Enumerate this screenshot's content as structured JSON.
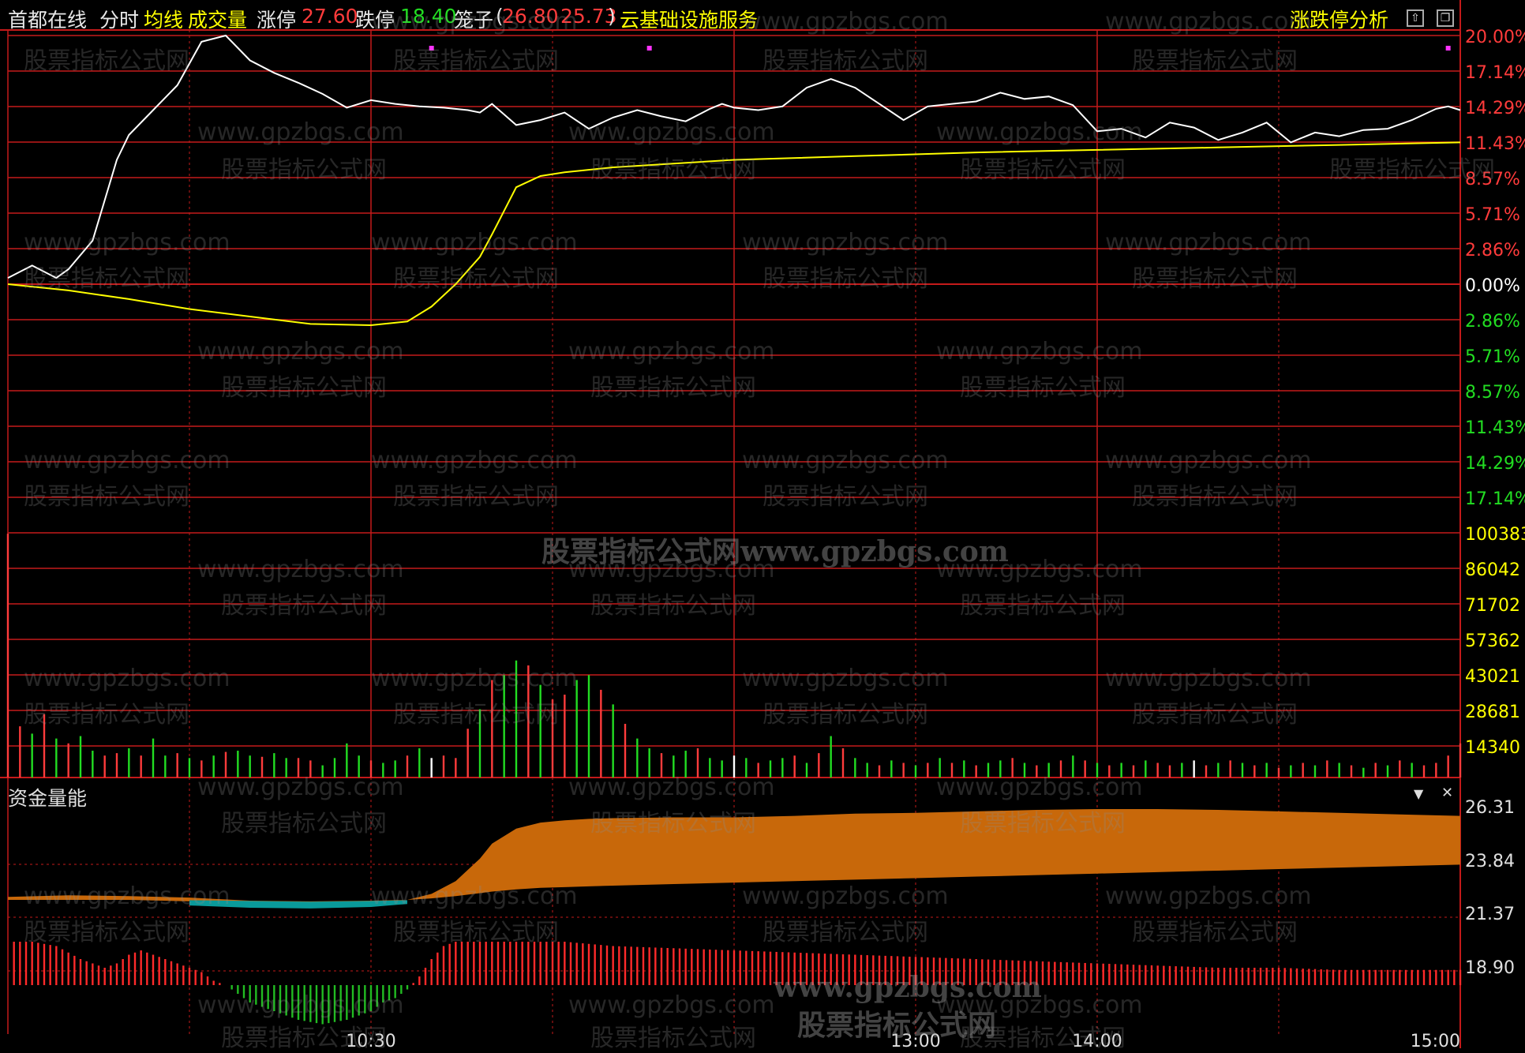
{
  "header": {
    "stock_name": "首都在线",
    "mode_label": "分时",
    "avg_label": "均线",
    "volume_label": "成交量",
    "limit_up_label": "涨停",
    "limit_up_value": "27.60",
    "limit_down_label": "跌停",
    "limit_down_value": "18.40",
    "cage_label": "笼子",
    "cage_open": "(",
    "cage_high": "26.80",
    "cage_low": "25.73",
    "cage_close": ")",
    "sector": "云基础设施服务",
    "analysis_button": "涨跌停分析",
    "btn_up_icon": "⇧",
    "btn_max_icon": "❐"
  },
  "price_axis": {
    "labels": [
      "20.00%",
      "17.14%",
      "14.29%",
      "11.43%",
      "8.57%",
      "5.71%",
      "2.86%",
      "0.00%",
      "2.86%",
      "5.71%",
      "8.57%",
      "11.43%",
      "14.29%",
      "17.14%"
    ],
    "colors": [
      "#ff3b3b",
      "#ff3b3b",
      "#ff3b3b",
      "#ff3b3b",
      "#ff3b3b",
      "#ff3b3b",
      "#ff3b3b",
      "#ffffff",
      "#22dd22",
      "#22dd22",
      "#22dd22",
      "#22dd22",
      "#22dd22",
      "#22dd22"
    ]
  },
  "volume_axis": {
    "labels": [
      "100383",
      "86042",
      "71702",
      "57362",
      "43021",
      "28681",
      "14340"
    ]
  },
  "indicator": {
    "title": "资金量能",
    "dropdown_icon": "▼",
    "close_icon": "✕",
    "axis_labels": [
      "26.31",
      "23.84",
      "21.37",
      "18.90"
    ]
  },
  "time_axis": {
    "labels": [
      "10:30",
      "13:00",
      "14:00",
      "15:00"
    ]
  },
  "chart_data": [
    {
      "type": "line",
      "title": "",
      "x_label": "",
      "y_label": "",
      "ylim": [
        -20,
        20
      ],
      "unit": "%",
      "series": [
        {
          "name": "分时",
          "color": "#ffffff",
          "x": [
            0,
            4,
            8,
            10,
            14,
            18,
            20,
            24,
            28,
            32,
            36,
            40,
            44,
            48,
            52,
            56,
            60,
            64,
            68,
            72,
            76,
            78,
            80,
            84,
            88,
            92,
            96,
            100,
            104,
            108,
            112,
            116,
            118,
            120,
            124,
            128,
            132,
            136,
            140,
            144,
            148,
            152,
            156,
            160,
            164,
            168,
            172,
            176,
            180,
            184,
            188,
            192,
            196,
            200,
            204,
            208,
            212,
            216,
            220,
            224,
            228,
            232,
            236,
            238,
            240
          ],
          "y": [
            0.5,
            1.5,
            0.5,
            1.2,
            3.5,
            10,
            12,
            14,
            16,
            19.5,
            20,
            18,
            17,
            16.2,
            15.3,
            14.2,
            14.8,
            14.5,
            14.3,
            14.2,
            14,
            13.8,
            14.5,
            12.8,
            13.2,
            13.8,
            12.5,
            13.4,
            14,
            13.5,
            13.1,
            14.1,
            14.5,
            14.2,
            14,
            14.3,
            15.8,
            16.5,
            15.8,
            14.5,
            13.2,
            14.3,
            14.5,
            14.7,
            15.4,
            14.9,
            15.1,
            14.4,
            12.3,
            12.5,
            11.8,
            13,
            12.6,
            11.6,
            12.2,
            13,
            11.4,
            12.2,
            11.9,
            12.4,
            12.5,
            13.2,
            14.1,
            14.3,
            14.0
          ]
        },
        {
          "name": "均线",
          "color": "#ffff00",
          "x": [
            0,
            10,
            20,
            30,
            40,
            50,
            60,
            66,
            70,
            74,
            78,
            80,
            84,
            88,
            92,
            96,
            100,
            110,
            120,
            140,
            160,
            180,
            200,
            220,
            240
          ],
          "y": [
            0.0,
            -0.5,
            -1.2,
            -2.0,
            -2.6,
            -3.2,
            -3.3,
            -3.0,
            -1.8,
            0.0,
            2.2,
            4.0,
            7.8,
            8.7,
            9.0,
            9.2,
            9.4,
            9.7,
            10.0,
            10.3,
            10.6,
            10.8,
            11.0,
            11.2,
            11.4
          ]
        }
      ]
    },
    {
      "type": "bar",
      "title": "",
      "x_label": "",
      "y_label": "",
      "ylim": [
        0,
        100383
      ],
      "series": [
        {
          "name": "成交量",
          "up_color": "#ff3b3b",
          "down_color": "#22dd22",
          "flat_color": "#ffffff",
          "x": [
            0,
            2,
            4,
            6,
            8,
            10,
            12,
            14,
            16,
            18,
            20,
            22,
            24,
            26,
            28,
            30,
            32,
            34,
            36,
            38,
            40,
            42,
            44,
            46,
            48,
            50,
            52,
            54,
            56,
            58,
            60,
            62,
            64,
            66,
            68,
            70,
            72,
            74,
            76,
            78,
            80,
            82,
            84,
            86,
            88,
            90,
            92,
            94,
            96,
            98,
            100,
            102,
            104,
            106,
            108,
            110,
            112,
            114,
            116,
            118,
            120,
            122,
            124,
            126,
            128,
            130,
            132,
            134,
            136,
            138,
            140,
            142,
            144,
            146,
            148,
            150,
            152,
            154,
            156,
            158,
            160,
            162,
            164,
            166,
            168,
            170,
            172,
            174,
            176,
            178,
            180,
            182,
            184,
            186,
            188,
            190,
            192,
            194,
            196,
            198,
            200,
            202,
            204,
            206,
            208,
            210,
            212,
            214,
            216,
            218,
            220,
            222,
            224,
            226,
            228,
            230,
            232,
            234,
            236,
            238,
            240
          ],
          "values": [
            100000,
            21000,
            18000,
            26000,
            16000,
            14000,
            17000,
            11000,
            9000,
            10000,
            12000,
            9000,
            16000,
            9000,
            10000,
            8000,
            7000,
            9000,
            10500,
            11000,
            9000,
            8500,
            10000,
            8000,
            8000,
            7000,
            5000,
            8000,
            14000,
            9000,
            7000,
            6000,
            7000,
            9000,
            12000,
            8000,
            9000,
            8000,
            20000,
            28000,
            40000,
            42000,
            48000,
            46000,
            38000,
            32000,
            34000,
            40000,
            42000,
            36000,
            30000,
            22000,
            16000,
            12000,
            10000,
            9000,
            11000,
            12000,
            8000,
            7000,
            9000,
            8000,
            6000,
            7000,
            8000,
            9000,
            6000,
            10000,
            17000,
            12000,
            8000,
            6000,
            5000,
            7000,
            6000,
            5000,
            6000,
            8000,
            6000,
            7000,
            5000,
            6000,
            7000,
            8000,
            6000,
            5000,
            6000,
            7000,
            9000,
            7000,
            6000,
            5000,
            6000,
            5000,
            7000,
            6000,
            5000,
            6000,
            7000,
            5000,
            6000,
            7000,
            6000,
            5000,
            6000,
            4000,
            5000,
            6000,
            5000,
            7000,
            6000,
            5000,
            4000,
            6000,
            5000,
            7000,
            6000,
            5000,
            6000,
            9000,
            14000
          ],
          "direction": [
            "up",
            "up",
            "down",
            "up",
            "down",
            "up",
            "down",
            "down",
            "up",
            "up",
            "down",
            "up",
            "down",
            "down",
            "up",
            "down",
            "up",
            "down",
            "up",
            "down",
            "down",
            "up",
            "down",
            "down",
            "up",
            "up",
            "down",
            "down",
            "down",
            "down",
            "up",
            "down",
            "down",
            "up",
            "down",
            "flat",
            "up",
            "up",
            "up",
            "down",
            "up",
            "down",
            "down",
            "up",
            "down",
            "up",
            "up",
            "down",
            "down",
            "up",
            "down",
            "up",
            "down",
            "down",
            "up",
            "down",
            "down",
            "up",
            "down",
            "down",
            "flat",
            "down",
            "up",
            "down",
            "down",
            "up",
            "down",
            "up",
            "down",
            "up",
            "down",
            "down",
            "up",
            "down",
            "up",
            "down",
            "up",
            "down",
            "up",
            "down",
            "up",
            "down",
            "down",
            "up",
            "down",
            "up",
            "down",
            "up",
            "down",
            "up",
            "down",
            "up",
            "down",
            "up",
            "down",
            "up",
            "up",
            "down",
            "flat",
            "up",
            "down",
            "up",
            "down",
            "up",
            "down",
            "up",
            "down",
            "up",
            "down",
            "up",
            "down",
            "up",
            "down",
            "up",
            "down",
            "up",
            "down",
            "up",
            "up",
            "up",
            "up"
          ]
        }
      ]
    },
    {
      "type": "area",
      "title": "",
      "x_label": "",
      "y_label": "",
      "series": [
        {
          "name": "资金量能-上沿",
          "color": "#c8680a",
          "x": [
            0,
            10,
            20,
            30,
            40,
            50,
            60,
            66,
            70,
            74,
            78,
            80,
            84,
            88,
            92,
            96,
            100,
            110,
            120,
            130,
            140,
            150,
            160,
            170,
            180,
            190,
            200,
            210,
            220,
            230,
            240
          ],
          "values": [
            0.4,
            0.6,
            0.5,
            0.3,
            -0.1,
            -0.2,
            -0.1,
            0.0,
            0.8,
            2.5,
            5.5,
            7.5,
            9.5,
            10.3,
            10.6,
            10.8,
            10.9,
            11.0,
            11.0,
            11.2,
            11.5,
            11.6,
            11.8,
            12.0,
            12.1,
            12.1,
            12.0,
            11.8,
            11.6,
            11.4,
            11.2
          ]
        },
        {
          "name": "资金量能-下沿",
          "color": "#0a9a9a",
          "x": [
            0,
            10,
            20,
            30,
            40,
            50,
            60,
            66,
            70,
            74,
            78,
            80,
            84,
            88,
            92,
            96,
            100,
            110,
            120,
            130,
            140,
            150,
            160,
            170,
            180,
            190,
            200,
            210,
            220,
            230,
            240
          ],
          "values": [
            0.0,
            0.0,
            0.0,
            -0.2,
            -0.5,
            -0.6,
            -0.4,
            0.0,
            0.2,
            0.5,
            0.9,
            1.1,
            1.4,
            1.6,
            1.7,
            1.8,
            1.9,
            2.1,
            2.3,
            2.5,
            2.7,
            2.9,
            3.1,
            3.3,
            3.5,
            3.7,
            3.9,
            4.1,
            4.3,
            4.5,
            4.7
          ]
        }
      ]
    },
    {
      "type": "bar",
      "title": "",
      "x_label": "",
      "y_label": "",
      "series": [
        {
          "name": "资金量能-柱",
          "positive_color": "#ff2a2a",
          "negative_color": "#22bb22",
          "x": [
            0,
            4,
            8,
            12,
            16,
            18,
            20,
            22,
            24,
            28,
            32,
            34,
            36,
            38,
            40,
            44,
            48,
            52,
            56,
            60,
            62,
            64,
            66,
            68,
            70,
            72,
            74,
            76,
            78,
            80,
            84,
            88,
            92,
            96,
            100,
            110,
            120,
            130,
            140,
            150,
            160,
            170,
            180,
            190,
            200,
            210,
            220,
            230,
            240
          ],
          "values": [
            10,
            10,
            9,
            6,
            4,
            5,
            7,
            8,
            7,
            5,
            3,
            1,
            0,
            -2,
            -4,
            -6,
            -8,
            -9,
            -8,
            -6,
            -4,
            -3,
            -1,
            2,
            6,
            9,
            10,
            10,
            10,
            10,
            10,
            10,
            10,
            9.5,
            9,
            8.5,
            8,
            7.5,
            7,
            6.5,
            6,
            5.5,
            5,
            4.5,
            4,
            4,
            3.5,
            3.5,
            3.5
          ]
        }
      ]
    }
  ]
}
